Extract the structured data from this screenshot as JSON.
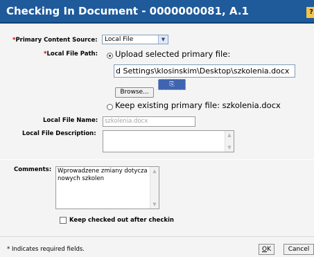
{
  "dialog": {
    "title": "Checking In Document - 0000000081, A.1",
    "help_glyph": "?"
  },
  "primary_source": {
    "required_mark": "*",
    "label": "Primary Content Source:",
    "value": "Local File"
  },
  "local_file_path": {
    "required_mark": "*",
    "label": "Local File Path:",
    "upload_option_label": "Upload selected primary file:",
    "path_value": "d Settings\\klosinskim\\Desktop\\szkolenia.docx",
    "browse_label": "Browse...",
    "keep_option_label": "Keep existing primary file: szkolenia.docx"
  },
  "local_file_name": {
    "label": "Local File Name:",
    "value": "szkolenia.docx"
  },
  "local_file_description": {
    "label": "Local File Description:",
    "value": ""
  },
  "comments": {
    "label": "Comments:",
    "value": "Wprowadzene zmiany dotycza nowych szkolen"
  },
  "keep_checked_out": {
    "label": "Keep checked out after checkin",
    "checked": false
  },
  "footer": {
    "required_note": "* Indicates required fields.",
    "ok_label": "OK",
    "ok_mnemonic": "O",
    "ok_rest": "K",
    "cancel_label": "Cancel"
  },
  "colors": {
    "title_bar": "#1f5a9a",
    "required_mark": "#c00000",
    "pane_background": "#f4f4f4"
  }
}
